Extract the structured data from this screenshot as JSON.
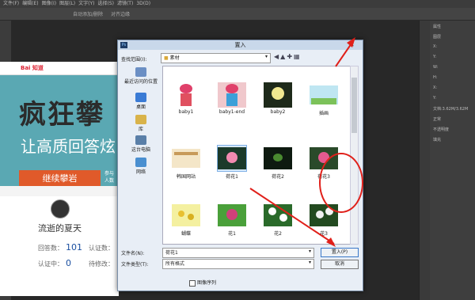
{
  "ps": {
    "menu": [
      "文件(F)",
      "编辑(E)",
      "图像(I)",
      "图层(L)",
      "文字(Y)",
      "选择(S)",
      "滤镜(T)",
      "3D(D)"
    ],
    "options": {
      "auto_select": "自动添加/删除",
      "align": "对齐边缘"
    },
    "right_panel": [
      "属性",
      "图层",
      "X:",
      "Y:",
      "W:",
      "H:",
      "X:",
      "Y:",
      "文档:3.62M/3.62M",
      "正常",
      "不透明度",
      "填充"
    ]
  },
  "webpage": {
    "brand": "Bai 知道",
    "headline": "疯狂攀",
    "subhead": "让高质回答炫",
    "cta": "继续攀岩",
    "side_note": [
      "参与",
      "人数"
    ],
    "username": "流逝的夏天",
    "stats": [
      {
        "label": "回答数：",
        "value": "101"
      },
      {
        "label": "认证数：",
        "value": ""
      },
      {
        "label": "认证中：",
        "value": "0"
      },
      {
        "label": "待修改：",
        "value": ""
      }
    ]
  },
  "dialog": {
    "title": "置入",
    "app_icon": "Ps",
    "look_in_label": "查找范围(I):",
    "look_in_value": "素材",
    "places": [
      "最近访问的位置",
      "桌面",
      "库",
      "这台电脑",
      "网络"
    ],
    "files": [
      {
        "name": "baby1",
        "kind": "pot-pink"
      },
      {
        "name": "baby1-end",
        "kind": "pot-blue"
      },
      {
        "name": "baby2",
        "kind": "flower-yellow"
      },
      {
        "name": "插画",
        "kind": "illustration"
      },
      {
        "name": "韩国网站",
        "kind": "website"
      },
      {
        "name": "荷花1",
        "kind": "lotus",
        "selected": true
      },
      {
        "name": "荷花2",
        "kind": "lotus-dark"
      },
      {
        "name": "荷花3",
        "kind": "lotus-pink"
      },
      {
        "name": "蝴蝶",
        "kind": "butterfly"
      },
      {
        "name": "花1",
        "kind": "flower-pink"
      },
      {
        "name": "花2",
        "kind": "flower-white"
      },
      {
        "name": "花3",
        "kind": "flower-white2"
      }
    ],
    "file_name_label": "文件名(N):",
    "file_name_value": "荷花1",
    "file_type_label": "文件类型(T):",
    "file_type_value": "所有格式",
    "ok_label": "置入(P)",
    "cancel_label": "取消",
    "sequence_label": "图像序列"
  }
}
